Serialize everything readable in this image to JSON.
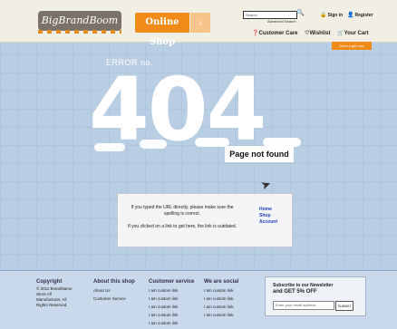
{
  "header": {
    "logo_text": "BigBrandBoom",
    "shop_button": "Online Shop",
    "shop_arrow": "↓",
    "search_placeholder": "Search",
    "advanced_search": "Advanced Search",
    "signin": "Sign in",
    "register": "Register",
    "nav": [
      "Customer Care",
      "Wishlist",
      "Your Cart"
    ],
    "gift_badge": "Send a gift now"
  },
  "error": {
    "label": "ERROR no.",
    "code": "404",
    "title": "Page not found"
  },
  "message": {
    "line1": "If you typed the URL directly, please make sure the spelling is correct.",
    "line2": "If you clicked on a link to get here, the link is outdated.",
    "links": [
      "Home",
      "Shop",
      "Account"
    ]
  },
  "footer": {
    "copyright": {
      "head": "Copyright",
      "lines": [
        "© 2011 BrandName",
        "Store All",
        "Manufacturer, All",
        "Rights Reserved."
      ]
    },
    "about": {
      "head": "About this shop",
      "items": [
        "About Us",
        "Customer Service"
      ]
    },
    "customer_service": {
      "head": "Customer service",
      "items": [
        "I am custom link",
        "I am custom link",
        "I am custom link",
        "I am custom link",
        "I am custom link"
      ]
    },
    "social": {
      "head": "We are social",
      "items": [
        "I am custom link",
        "I am custom link",
        "I am custom link",
        "I am custom link"
      ]
    },
    "subscribe": {
      "title": "Subscribe to our Newsletter",
      "offer": "and GET 5% OFF",
      "placeholder": "Enter your email address",
      "button": "SUBMIT"
    }
  },
  "colors": {
    "accent": "#f08a19",
    "background": "#b9cde3",
    "link": "#1e3fb6"
  }
}
